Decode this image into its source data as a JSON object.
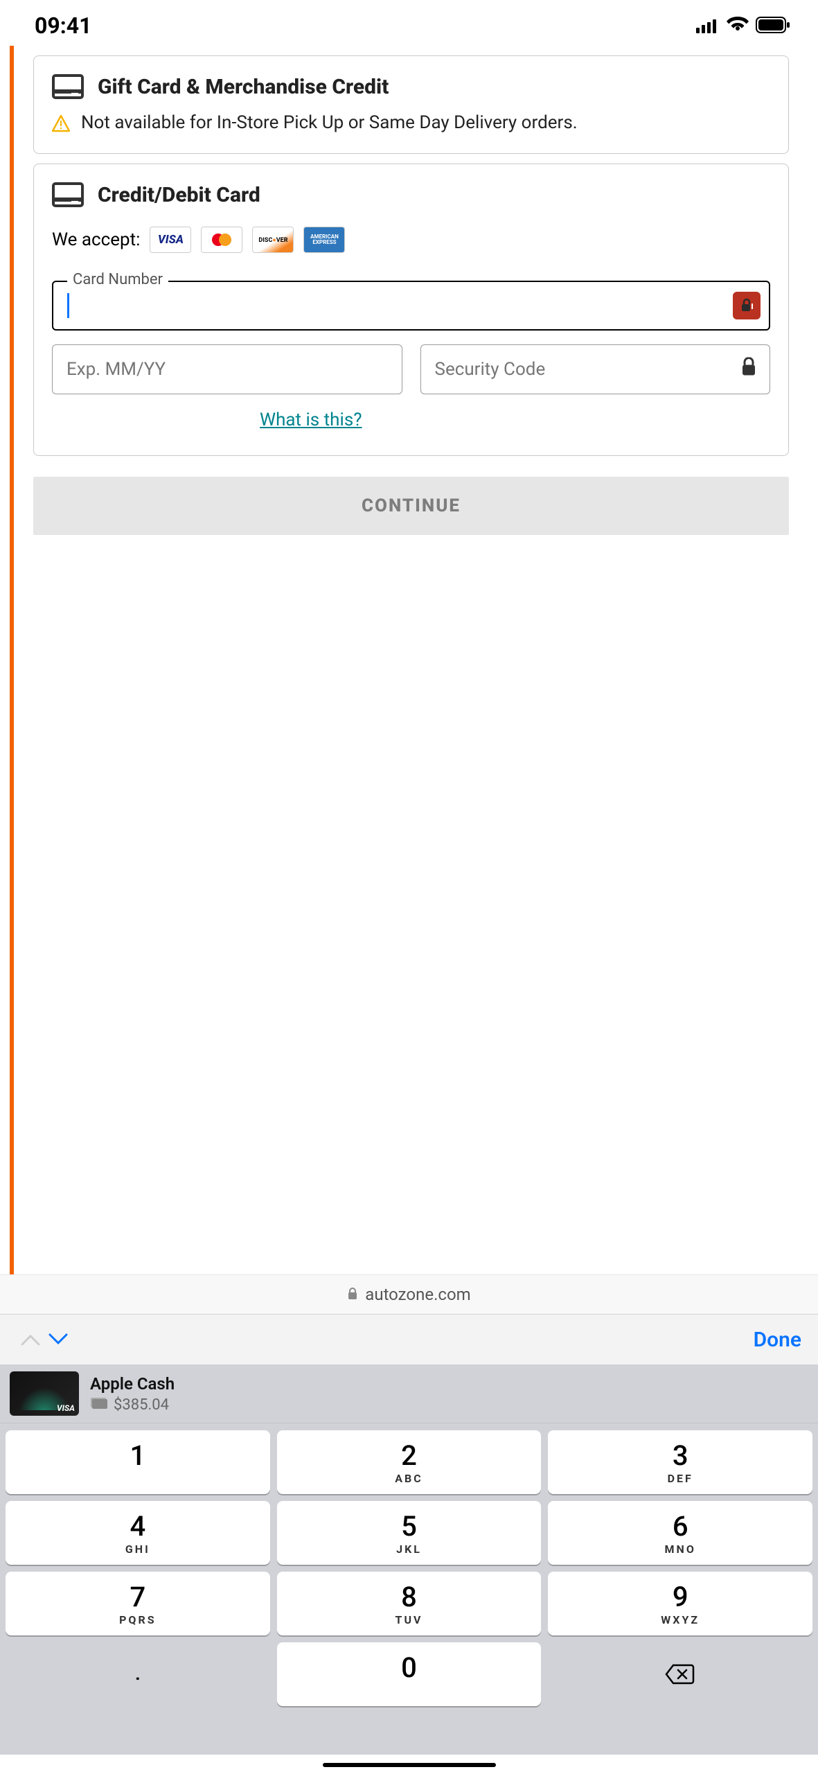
{
  "status": {
    "time": "09:41"
  },
  "giftcard": {
    "title": "Gift Card & Merchandise Credit",
    "note": "Not available for In-Store Pick Up or Same Day Delivery orders."
  },
  "card": {
    "title": "Credit/Debit Card",
    "accept_label": "We accept:",
    "networks": [
      "VISA",
      "MC",
      "DISCOVER",
      "AMEX"
    ],
    "card_number_label": "Card Number",
    "card_number_value": "",
    "exp_placeholder": "Exp. MM/YY",
    "cvv_placeholder": "Security Code",
    "what_is_this": "What is this?"
  },
  "continue_label": "CONTINUE",
  "url": "autozone.com",
  "keyboard_accessory": {
    "done": "Done"
  },
  "wallet": {
    "name": "Apple Cash",
    "amount": "$385.04",
    "brand": "VISA"
  },
  "keypad": [
    [
      {
        "d": "1",
        "l": ""
      },
      {
        "d": "2",
        "l": "ABC"
      },
      {
        "d": "3",
        "l": "DEF"
      }
    ],
    [
      {
        "d": "4",
        "l": "GHI"
      },
      {
        "d": "5",
        "l": "JKL"
      },
      {
        "d": "6",
        "l": "MNO"
      }
    ],
    [
      {
        "d": "7",
        "l": "PQRS"
      },
      {
        "d": "8",
        "l": "TUV"
      },
      {
        "d": "9",
        "l": "WXYZ"
      }
    ],
    [
      {
        "d": ".",
        "l": "",
        "type": "blank"
      },
      {
        "d": "0",
        "l": ""
      },
      {
        "d": "del",
        "l": "",
        "type": "util"
      }
    ]
  ]
}
